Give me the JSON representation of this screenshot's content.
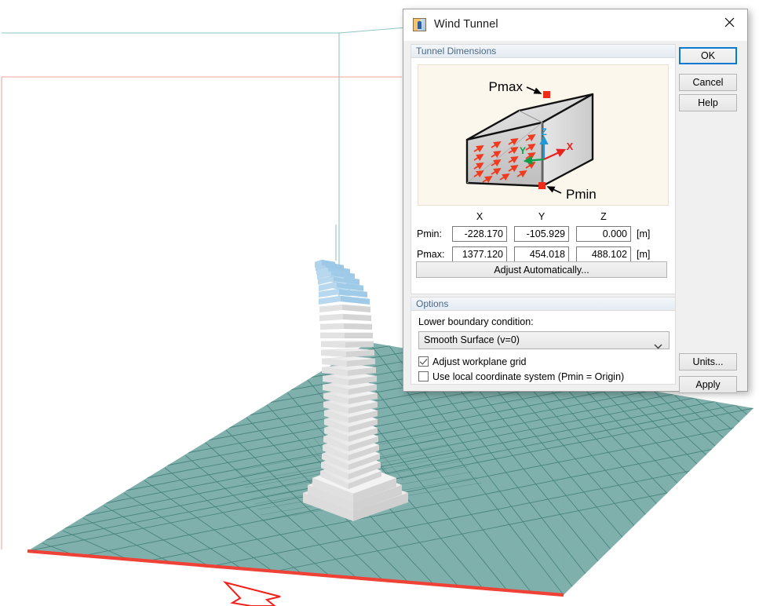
{
  "window": {
    "title": "Wind Tunnel",
    "icon": "wind-tunnel-app-icon",
    "close_icon": "close-icon"
  },
  "groups": {
    "tunnel_dimensions": {
      "title": "Tunnel Dimensions",
      "diagram": {
        "label_pmax": "Pmax",
        "label_pmin": "Pmin",
        "axis_x": "X",
        "axis_y": "Y",
        "axis_z": "Z",
        "colors": {
          "axis_x": "#e8221f",
          "axis_y": "#08a04a",
          "axis_z": "#1f9ad6",
          "flow_arrow": "#f03b21",
          "point_marker": "#ee2b18",
          "background": "#fbf7ec"
        }
      },
      "columns": [
        "X",
        "Y",
        "Z"
      ],
      "rows": [
        {
          "label": "Pmin:",
          "x": "-228.170",
          "y": "-105.929",
          "z": "0.000",
          "unit": "[m]"
        },
        {
          "label": "Pmax:",
          "x": "1377.120",
          "y": "454.018",
          "z": "488.102",
          "unit": "[m]"
        }
      ],
      "adjust_button": "Adjust Automatically..."
    },
    "options": {
      "title": "Options",
      "lower_boundary_label": "Lower boundary condition:",
      "lower_boundary_value": "Smooth Surface (v=0)",
      "checkbox_workplane": {
        "label": "Adjust workplane grid",
        "checked": true
      },
      "checkbox_local_cs": {
        "label": "Use local coordinate system (Pmin = Origin)",
        "checked": false
      }
    }
  },
  "buttons": {
    "ok": "OK",
    "cancel": "Cancel",
    "help": "Help",
    "units": "Units...",
    "apply": "Apply"
  },
  "viewport": {
    "ground_color": "#7cada9",
    "ground_grid_color": "#3f7d78",
    "bbox_front_color": "#ef4136",
    "bbox_line_red": "#f3a6a0",
    "bbox_line_teal": "#8fc6c4",
    "building_body_color": "#f4f4f4",
    "building_top_color": "#aad4ef",
    "wind_arrow_color": "#f2201a"
  }
}
